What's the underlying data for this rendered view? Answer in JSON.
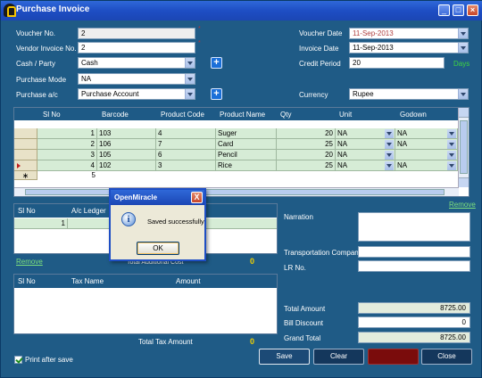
{
  "window": {
    "title": "Purchase Invoice"
  },
  "form": {
    "voucher_no_label": "Voucher No.",
    "voucher_no": "2",
    "vendor_invoice_label": "Vendor Invoice No.",
    "vendor_invoice": "2",
    "cash_party_label": "Cash / Party",
    "cash_party": "Cash",
    "purchase_mode_label": "Purchase Mode",
    "purchase_mode": "NA",
    "purchase_ac_label": "Purchase a/c",
    "purchase_ac": "Purchase Account",
    "voucher_date_label": "Voucher Date",
    "voucher_date": "11-Sep-2013",
    "invoice_date_label": "Invoice Date",
    "invoice_date": "11-Sep-2013",
    "credit_period_label": "Credit Period",
    "credit_period": "20",
    "days_label": "Days",
    "currency_label": "Currency",
    "currency": "Rupee",
    "required_marker": "*"
  },
  "product_grid": {
    "columns": [
      "Sl No",
      "Barcode",
      "Product Code",
      "Product Name",
      "Qty",
      "Unit",
      "Godown"
    ],
    "rows": [
      {
        "sl": "1",
        "barcode": "103",
        "code": "4",
        "name": "Suger",
        "qty": "20",
        "unit": "NA",
        "godown": "NA"
      },
      {
        "sl": "2",
        "barcode": "106",
        "code": "7",
        "name": "Card",
        "qty": "25",
        "unit": "NA",
        "godown": "NA"
      },
      {
        "sl": "3",
        "barcode": "105",
        "code": "6",
        "name": "Pencil",
        "qty": "20",
        "unit": "NA",
        "godown": ""
      },
      {
        "sl": "4",
        "barcode": "102",
        "code": "3",
        "name": "Rice",
        "qty": "25",
        "unit": "NA",
        "godown": "NA"
      },
      {
        "sl": "5",
        "barcode": "",
        "code": "",
        "name": "",
        "qty": "",
        "unit": "",
        "godown": ""
      }
    ],
    "remove_label": "Remove"
  },
  "ledger_grid": {
    "columns": [
      "Sl No",
      "A/c Ledger"
    ],
    "rows": [
      {
        "sl": "1"
      }
    ],
    "remove_label": "Remove",
    "total_label": "Total Additional Cost",
    "total": "0"
  },
  "tax_grid": {
    "columns": [
      "Sl No",
      "Tax Name",
      "Amount"
    ],
    "total_label": "Total Tax Amount",
    "total": "0"
  },
  "right": {
    "narration_label": "Narration",
    "transport_label": "Transportation Company",
    "lr_label": "LR No.",
    "total_amount_label": "Total Amount",
    "total_amount": "8725.00",
    "bill_discount_label": "Bill Discount",
    "bill_discount": "0",
    "grand_total_label": "Grand Total",
    "grand_total": "8725.00"
  },
  "print_after_save_label": "Print after save",
  "buttons": {
    "save": "Save",
    "clear": "Clear",
    "close": "Close"
  },
  "dialog": {
    "title": "OpenMiracle",
    "message": "Saved successfully",
    "ok": "OK",
    "close_glyph": "X"
  }
}
